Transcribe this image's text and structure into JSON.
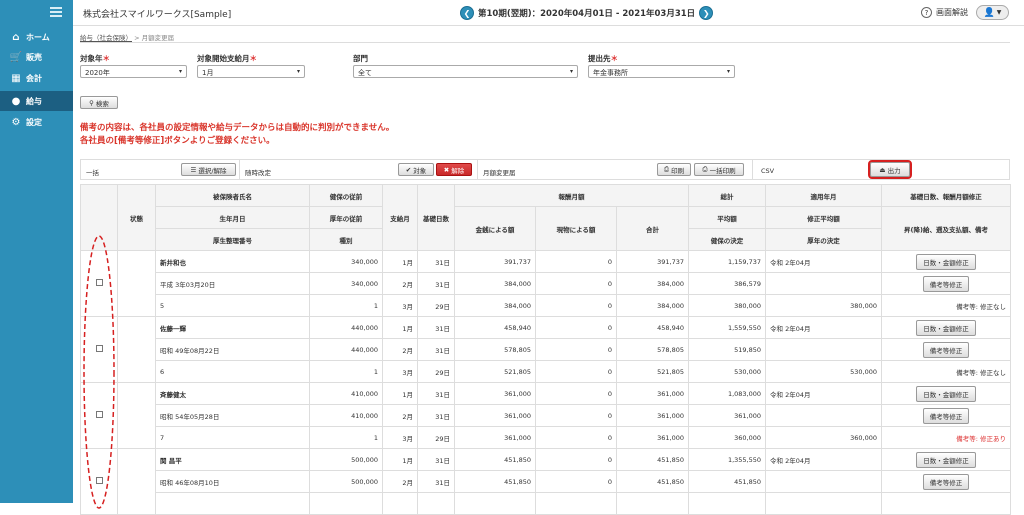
{
  "sidebar": {
    "items": [
      {
        "label": "ホーム",
        "icon": "home-icon",
        "glyph": "⌂"
      },
      {
        "label": "販売",
        "icon": "cart-icon",
        "glyph": "🛒"
      },
      {
        "label": "会計",
        "icon": "calculator-icon",
        "glyph": "▦"
      },
      {
        "label": "給与",
        "icon": "salary-icon",
        "glyph": "●"
      },
      {
        "label": "設定",
        "icon": "gear-icon",
        "glyph": "⚙"
      }
    ],
    "active_index": 3
  },
  "header": {
    "company": "株式会社スマイルワークス[Sample]",
    "period": "第10期(翌期)：2020年04月01日 - 2021年03月31日",
    "help": "画面解説"
  },
  "breadcrumb": {
    "parent": "給与（社会保険）",
    "current": "月額変更届"
  },
  "filters": {
    "year": {
      "label": "対象年",
      "value": "2020年"
    },
    "start_month": {
      "label": "対象開始支給月",
      "value": "1月"
    },
    "department": {
      "label": "部門",
      "value": "全て"
    },
    "submit_to": {
      "label": "提出先",
      "value": "年金事務所"
    }
  },
  "search_label": "検索",
  "warnings": [
    "備考の内容は、各社員の設定情報や給与データからは自動的に判別ができません。",
    "各社員の[備考等修正]ボタンよりご登録ください。"
  ],
  "toolbar": {
    "bulk": "一括",
    "select_toggle": "選択/解除",
    "adhoc": "随時改定",
    "target": "対象",
    "release": "解除",
    "monthly": "月額変更届",
    "print": "印刷",
    "bulk_print": "一括印刷",
    "csv": "CSV",
    "output": "出力"
  },
  "columns": {
    "status": "状態",
    "name": "被保険者氏名",
    "birth": "生年月日",
    "pension_no": "厚生整理番号",
    "health_prev": "健保の従前",
    "pension_prev": "厚年の従前",
    "kind": "種別",
    "pay_month": "支給月",
    "base_days": "基礎日数",
    "remuneration": "報酬月額",
    "cash": "金銭による額",
    "goods": "現物による額",
    "sum": "合計",
    "total": "総計",
    "average": "平均額",
    "health_decision": "健保の決定",
    "applied_month": "適用年月",
    "revised_avg": "修正平均額",
    "pension_decision": "厚年の決定",
    "days_fix_head": "基礎日数、報酬月額修正",
    "notes_head": "昇(降)給、遡及支払額、備考"
  },
  "employees": [
    {
      "name": "新井和也",
      "birth": "平成 3年03月20日",
      "no": "5",
      "prev": [
        "340,000",
        "340,000",
        "1"
      ],
      "months": [
        {
          "m": "1月",
          "d": "31日",
          "cash": "391,737",
          "goods": "0",
          "sum": "391,737"
        },
        {
          "m": "2月",
          "d": "31日",
          "cash": "384,000",
          "goods": "0",
          "sum": "384,000"
        },
        {
          "m": "3月",
          "d": "29日",
          "cash": "384,000",
          "goods": "0",
          "sum": "384,000"
        }
      ],
      "total": "1,159,737",
      "average": "386,579",
      "health": "380,000",
      "applied": "令和 2年04月",
      "revised": "",
      "pension": "380,000",
      "btn_days": "日数・金額修正",
      "btn_notes": "備考等修正",
      "note": "備考等: 修正なし",
      "note_red": false
    },
    {
      "name": "佐藤一輝",
      "birth": "昭和 49年08月22日",
      "no": "6",
      "prev": [
        "440,000",
        "440,000",
        "1"
      ],
      "months": [
        {
          "m": "1月",
          "d": "31日",
          "cash": "458,940",
          "goods": "0",
          "sum": "458,940"
        },
        {
          "m": "2月",
          "d": "31日",
          "cash": "578,805",
          "goods": "0",
          "sum": "578,805"
        },
        {
          "m": "3月",
          "d": "29日",
          "cash": "521,805",
          "goods": "0",
          "sum": "521,805"
        }
      ],
      "total": "1,559,550",
      "average": "519,850",
      "health": "530,000",
      "applied": "令和 2年04月",
      "revised": "",
      "pension": "530,000",
      "btn_days": "日数・金額修正",
      "btn_notes": "備考等修正",
      "note": "備考等: 修正なし",
      "note_red": false
    },
    {
      "name": "斉藤健太",
      "birth": "昭和 54年05月28日",
      "no": "7",
      "prev": [
        "410,000",
        "410,000",
        "1"
      ],
      "months": [
        {
          "m": "1月",
          "d": "31日",
          "cash": "361,000",
          "goods": "0",
          "sum": "361,000"
        },
        {
          "m": "2月",
          "d": "31日",
          "cash": "361,000",
          "goods": "0",
          "sum": "361,000"
        },
        {
          "m": "3月",
          "d": "29日",
          "cash": "361,000",
          "goods": "0",
          "sum": "361,000"
        }
      ],
      "total": "1,083,000",
      "average": "361,000",
      "health": "360,000",
      "applied": "令和 2年04月",
      "revised": "",
      "pension": "360,000",
      "btn_days": "日数・金額修正",
      "btn_notes": "備考等修正",
      "note": "備考等: 修正あり",
      "note_red": true
    },
    {
      "name": "関 昌平",
      "birth": "昭和 46年08月10日",
      "no": "",
      "prev": [
        "500,000",
        "500,000",
        ""
      ],
      "months": [
        {
          "m": "1月",
          "d": "31日",
          "cash": "451,850",
          "goods": "0",
          "sum": "451,850"
        },
        {
          "m": "2月",
          "d": "31日",
          "cash": "451,850",
          "goods": "0",
          "sum": "451,850"
        }
      ],
      "total": "1,355,550",
      "average": "451,850",
      "health": "",
      "applied": "令和 2年04月",
      "revised": "",
      "pension": "",
      "btn_days": "日数・金額修正",
      "btn_notes": "備考等修正",
      "note": "",
      "note_red": false
    }
  ]
}
